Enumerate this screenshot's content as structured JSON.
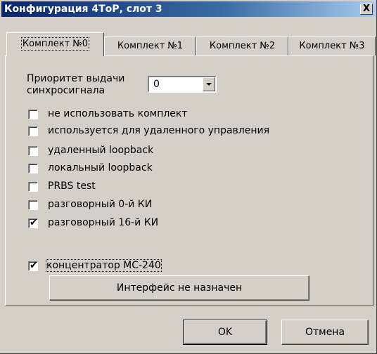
{
  "window": {
    "title": "Конфигурация 4ТоР, слот 3",
    "close_label": "X"
  },
  "tabs": [
    {
      "label": "Комплект №0",
      "selected": true
    },
    {
      "label": "Комплект №1",
      "selected": false
    },
    {
      "label": "Комплект №2",
      "selected": false
    },
    {
      "label": "Комплект №3",
      "selected": false
    }
  ],
  "priority": {
    "label_line1": "Приоритет выдачи",
    "label_line2": "синхросигнала",
    "value": "0"
  },
  "options": [
    {
      "label": "не использовать комплект",
      "checked": false
    },
    {
      "label": "используется для удаленного управления",
      "checked": false
    },
    {
      "label": "удаленный loopback",
      "checked": false
    },
    {
      "label": "локальный loopback",
      "checked": false
    },
    {
      "label": "PRBS test",
      "checked": false
    },
    {
      "label": "разговорный 0-й КИ",
      "checked": false
    },
    {
      "label": "разговорный 16-й КИ",
      "checked": true
    }
  ],
  "concentrator": {
    "label": "концентратор МС-240",
    "checked": true
  },
  "interface_button": "Интерфейс не назначен",
  "buttons": {
    "ok": "OK",
    "cancel": "Отмена"
  }
}
